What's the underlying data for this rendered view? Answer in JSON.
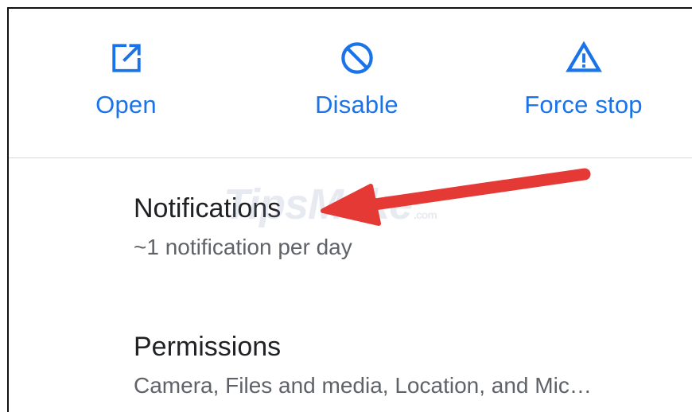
{
  "actions": {
    "open_label": "Open",
    "disable_label": "Disable",
    "force_stop_label": "Force stop"
  },
  "settings": {
    "notifications": {
      "title": "Notifications",
      "summary": "~1 notification per day"
    },
    "permissions": {
      "title": "Permissions",
      "summary": "Camera, Files and media, Location, and Mic…"
    }
  },
  "watermark": {
    "brand": "TipsMake",
    "suffix": ".com"
  },
  "icons": {
    "open": "open-in-new-icon",
    "disable": "block-icon",
    "force_stop": "warning-icon"
  },
  "colors": {
    "accent": "#1a73e8",
    "annotation_arrow": "#e53935"
  }
}
